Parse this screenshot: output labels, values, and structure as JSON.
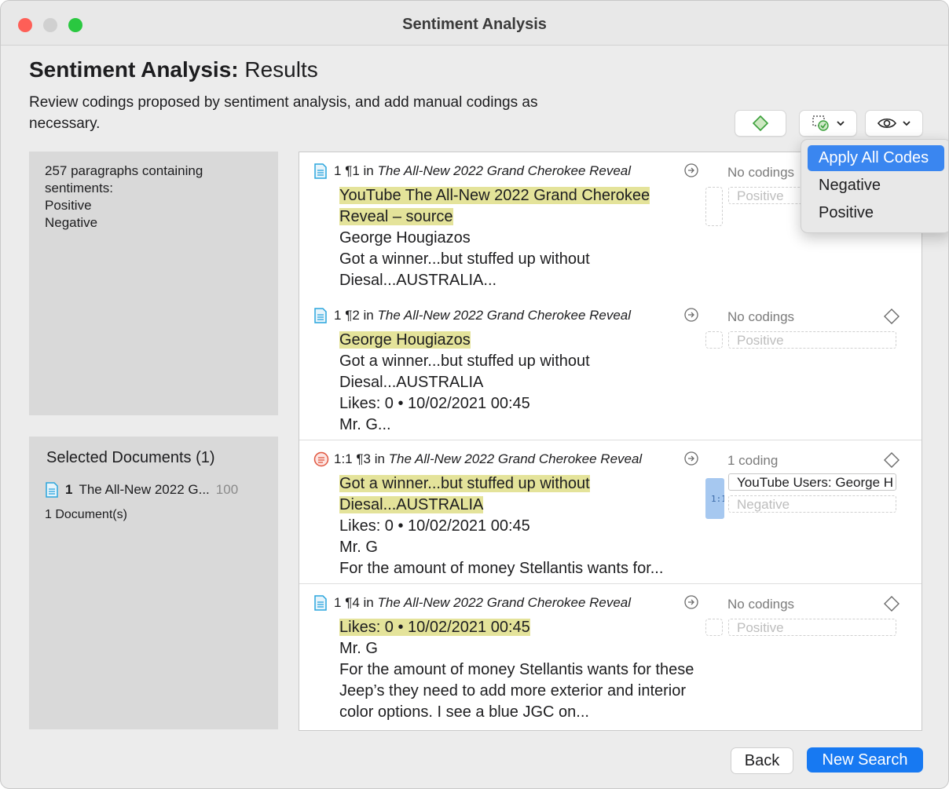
{
  "window": {
    "title": "Sentiment Analysis"
  },
  "header": {
    "title_bold": "Sentiment Analysis:",
    "title_rest": "Results",
    "subtitle": "Review codings proposed by sentiment analysis, and add manual codings as necessary."
  },
  "summary": {
    "text": "257 paragraphs containing sentiments:",
    "sentiments": [
      "Positive",
      "Negative"
    ]
  },
  "documents": {
    "heading": "Selected Documents (1)",
    "items": [
      {
        "num": "1",
        "name": "The All-New 2022 G...",
        "count": "100"
      }
    ],
    "count_label": "1 Document(s)"
  },
  "results": [
    {
      "num": "1",
      "para": "¶1",
      "in": "in",
      "source": "The All-New 2022 Grand Cherokee Reveal",
      "icon": "document-icon",
      "highlight": "YouTube  The All-New 2022 Grand Cherokee Reveal – source",
      "rest": "George Hougiazos\nGot a winner...but stuffed up without Diesal...AUSTRALIA...",
      "status": "No codings",
      "codes": [
        {
          "label": "Positive",
          "style": "dashed"
        }
      ]
    },
    {
      "num": "1",
      "para": "¶2",
      "in": "in",
      "source": "The All-New 2022 Grand Cherokee Reveal",
      "icon": "document-icon",
      "highlight": "George Hougiazos",
      "rest": "Got a winner...but stuffed up without Diesal...AUSTRALIA\nLikes: 0 • 10/02/2021 00:45\nMr. G...",
      "status": "No codings",
      "codes": [
        {
          "label": "Positive",
          "style": "dashed"
        }
      ]
    },
    {
      "num": "1:1",
      "para": "¶3",
      "in": "in",
      "source": "The All-New 2022 Grand Cherokee Reveal",
      "icon": "coded-segment-icon",
      "highlight": "Got a winner...but stuffed up without Diesal...AUSTRALIA",
      "rest": "Likes: 0 • 10/02/2021 00:45\nMr. G\nFor the amount of money Stellantis wants for...",
      "status": "1 coding",
      "codes": [
        {
          "label": "YouTube Users: George H",
          "style": "solid"
        },
        {
          "label": "Negative",
          "style": "dashed"
        }
      ]
    },
    {
      "num": "1",
      "para": "¶4",
      "in": "in",
      "source": "The All-New 2022 Grand Cherokee Reveal",
      "icon": "document-icon",
      "highlight": "Likes: 0 • 10/02/2021 00:45",
      "rest": "Mr. G\nFor the amount of money Stellantis wants for these Jeep’s they need to add more exterior and interior color options. I see a blue JGC on...",
      "status": "No codings",
      "codes": [
        {
          "label": "Positive",
          "style": "dashed"
        }
      ]
    }
  ],
  "dropdown": {
    "items": [
      "Apply All Codes",
      "Negative",
      "Positive"
    ],
    "selected": "Apply All Codes"
  },
  "footer": {
    "back": "Back",
    "new_search": "New Search"
  },
  "colors": {
    "accent": "#1779f2",
    "highlight": "#e4e39a",
    "panel": "#d9d9d9",
    "selection": "#3a86f0"
  }
}
